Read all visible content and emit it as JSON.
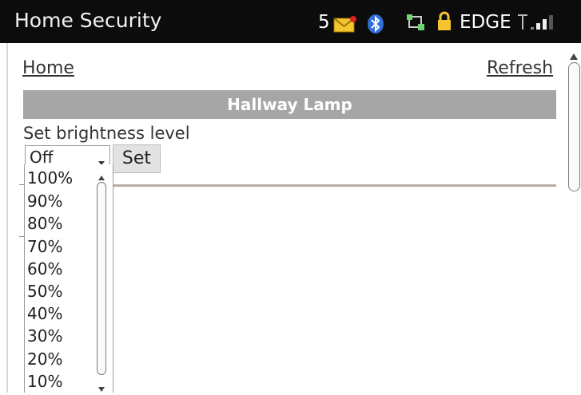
{
  "status_bar": {
    "app_title": "Home Security",
    "message_count": "5",
    "network": "EDGE",
    "icons": [
      "envelope-icon",
      "bluetooth-icon",
      "data-transfer-icon",
      "lock-icon",
      "signal-icon"
    ]
  },
  "nav": {
    "home_label": "Home",
    "refresh_label": "Refresh"
  },
  "device": {
    "name": "Hallway Lamp",
    "instruction": "Set brightness level"
  },
  "brightness_select": {
    "selected": "Off",
    "options": [
      "100%",
      "90%",
      "80%",
      "70%",
      "60%",
      "50%",
      "40%",
      "30%",
      "20%",
      "10%"
    ]
  },
  "set_button_label": "Set",
  "colors": {
    "status_bar_bg": "#0c0c0c",
    "heading_bar_bg": "#a6a6a6",
    "divider": "#b8aca3"
  }
}
